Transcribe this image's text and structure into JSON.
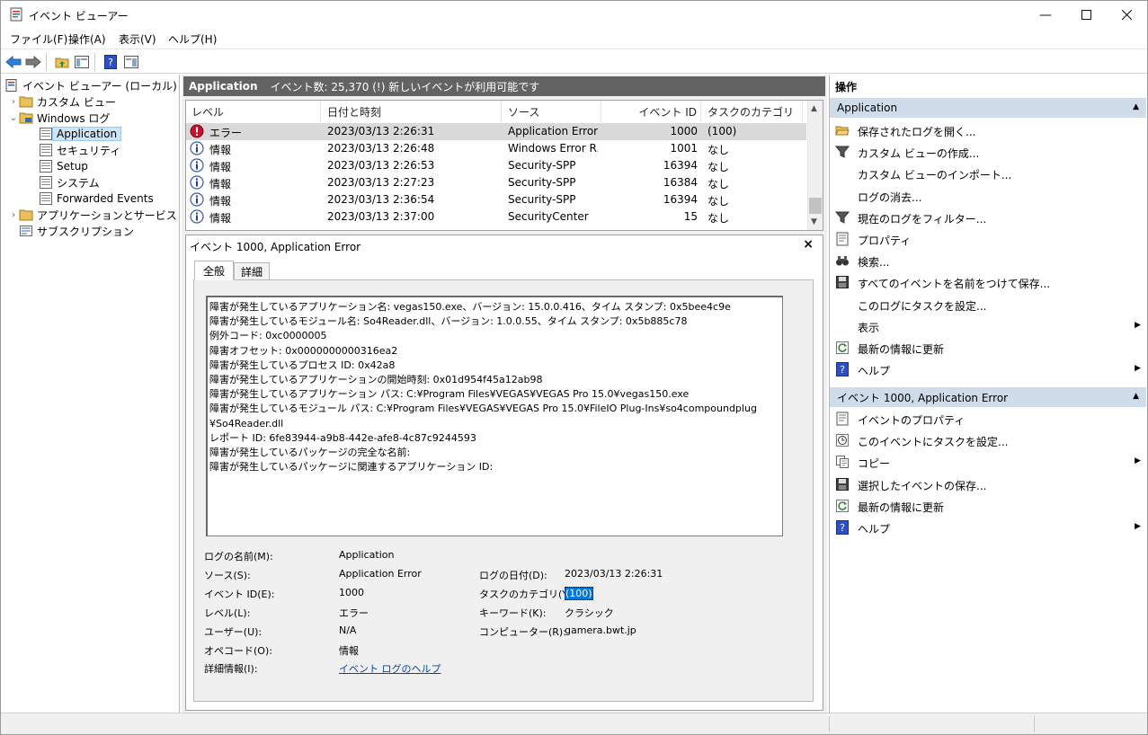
{
  "window": {
    "title": "イベント ビューアー"
  },
  "menu": [
    "ファイル(F)",
    "操作(A)",
    "表示(V)",
    "ヘルプ(H)"
  ],
  "tree": {
    "root": "イベント ビューアー (ローカル)",
    "custom_views": "カスタム ビュー",
    "windows_logs": "Windows ログ",
    "logs": [
      "Application",
      "セキュリティ",
      "Setup",
      "システム",
      "Forwarded Events"
    ],
    "apps_services": "アプリケーションとサービス ログ",
    "subscriptions": "サブスクリプション"
  },
  "center": {
    "header_title": "Application",
    "header_info": "イベント数: 25,370 (!) 新しいイベントが利用可能です",
    "columns": [
      "レベル",
      "日付と時刻",
      "ソース",
      "イベント ID",
      "タスクのカテゴリ"
    ],
    "rows": [
      {
        "level": "エラー",
        "level_icon": "error-icon",
        "date": "2023/03/13 2:26:31",
        "source": "Application Error",
        "id": "1000",
        "task": "(100)"
      },
      {
        "level": "情報",
        "level_icon": "info-icon",
        "date": "2023/03/13 2:26:48",
        "source": "Windows Error R...",
        "id": "1001",
        "task": "なし"
      },
      {
        "level": "情報",
        "level_icon": "info-icon",
        "date": "2023/03/13 2:26:53",
        "source": "Security-SPP",
        "id": "16394",
        "task": "なし"
      },
      {
        "level": "情報",
        "level_icon": "info-icon",
        "date": "2023/03/13 2:27:23",
        "source": "Security-SPP",
        "id": "16384",
        "task": "なし"
      },
      {
        "level": "情報",
        "level_icon": "info-icon",
        "date": "2023/03/13 2:36:54",
        "source": "Security-SPP",
        "id": "16394",
        "task": "なし"
      },
      {
        "level": "情報",
        "level_icon": "info-icon",
        "date": "2023/03/13 2:37:00",
        "source": "SecurityCenter",
        "id": "15",
        "task": "なし"
      }
    ]
  },
  "detail": {
    "title": "イベント 1000, Application Error",
    "tabs": [
      "全般",
      "詳細"
    ],
    "description": "障害が発生しているアプリケーション名: vegas150.exe、バージョン: 15.0.0.416、タイム スタンプ: 0x5bee4c9e\n障害が発生しているモジュール名: So4Reader.dll、バージョン: 1.0.0.55、タイム スタンプ: 0x5b885c78\n例外コード: 0xc0000005\n障害オフセット: 0x0000000000316ea2\n障害が発生しているプロセス ID: 0x42a8\n障害が発生しているアプリケーションの開始時刻: 0x01d954f45a12ab98\n障害が発生しているアプリケーション パス: C:¥Program Files¥VEGAS¥VEGAS Pro 15.0¥vegas150.exe\n障害が発生しているモジュール パス: C:¥Program Files¥VEGAS¥VEGAS Pro 15.0¥FileIO Plug-Ins¥so4compoundplug\n¥So4Reader.dll\nレポート ID: 6fe83944-a9b8-442e-afe8-4c87c9244593\n障害が発生しているパッケージの完全な名前:\n障害が発生しているパッケージに関連するアプリケーション ID:",
    "fields": {
      "log_name_label": "ログの名前(M):",
      "log_name": "Application",
      "source_label": "ソース(S):",
      "source": "Application Error",
      "date_label": "ログの日付(D):",
      "date": "2023/03/13 2:26:31",
      "event_id_label": "イベント ID(E):",
      "event_id": "1000",
      "task_label": "タスクのカテゴリ(Y):",
      "task": "(100)",
      "level_label": "レベル(L):",
      "level": "エラー",
      "keyword_label": "キーワード(K):",
      "keyword": "クラシック",
      "user_label": "ユーザー(U):",
      "user": "N/A",
      "computer_label": "コンピューター(R):",
      "computer": "gamera.bwt.jp",
      "opcode_label": "オペコード(O):",
      "opcode": "情報",
      "more_label": "詳細情報(I):",
      "more_link": "イベント ログのヘルプ"
    }
  },
  "actions": {
    "header": "操作",
    "section1": "Application",
    "items1": [
      {
        "label": "保存されたログを開く...",
        "icon": "folder-open-icon"
      },
      {
        "label": "カスタム ビューの作成...",
        "icon": "filter-icon"
      },
      {
        "label": "カスタム ビューのインポート...",
        "icon": ""
      },
      {
        "label": "ログの消去...",
        "icon": ""
      },
      {
        "label": "現在のログをフィルター...",
        "icon": "filter-icon"
      },
      {
        "label": "プロパティ",
        "icon": "properties-icon"
      },
      {
        "label": "検索...",
        "icon": "binoculars-icon"
      },
      {
        "label": "すべてのイベントを名前をつけて保存...",
        "icon": "save-icon"
      },
      {
        "label": "このログにタスクを設定...",
        "icon": ""
      },
      {
        "label": "表示",
        "icon": "",
        "submenu": true
      },
      {
        "label": "最新の情報に更新",
        "icon": "refresh-icon"
      },
      {
        "label": "ヘルプ",
        "icon": "help-icon",
        "submenu": true
      }
    ],
    "section2": "イベント 1000, Application Error",
    "items2": [
      {
        "label": "イベントのプロパティ",
        "icon": "properties-icon"
      },
      {
        "label": "このイベントにタスクを設定...",
        "icon": "task-clock-icon"
      },
      {
        "label": "コピー",
        "icon": "copy-icon",
        "submenu": true
      },
      {
        "label": "選択したイベントの保存...",
        "icon": "save-icon"
      },
      {
        "label": "最新の情報に更新",
        "icon": "refresh-icon"
      },
      {
        "label": "ヘルプ",
        "icon": "help-icon",
        "submenu": true
      }
    ]
  }
}
